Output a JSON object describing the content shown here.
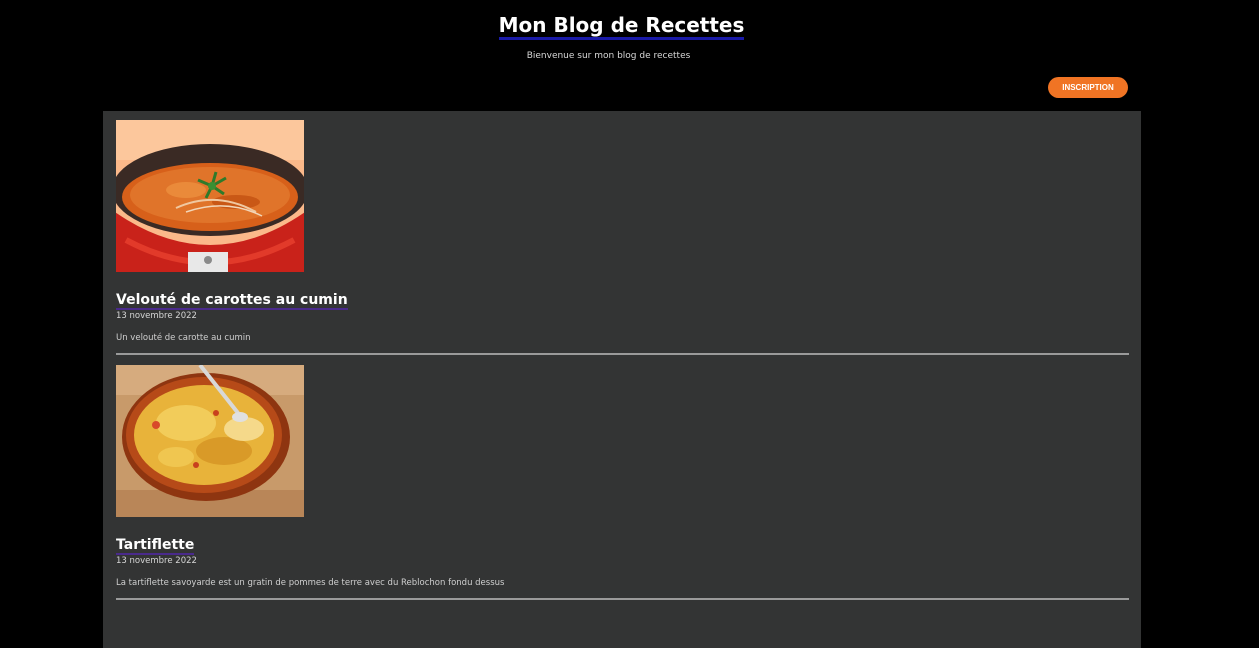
{
  "header": {
    "title": "Mon Blog de Recettes",
    "subtitle": "Bienvenue sur mon blog de recettes",
    "signup_label": "INSCRIPTION"
  },
  "articles": [
    {
      "title": "Velouté de carottes au cumin",
      "date": "13 novembre 2022",
      "excerpt": "Un velouté de carotte au cumin",
      "image": "carrot-soup-image"
    },
    {
      "title": "Tartiflette",
      "date": "13 novembre 2022",
      "excerpt": "La tartiflette savoyarde est un gratin de pommes de terre avec du Reblochon fondu dessus",
      "image": "tartiflette-image"
    }
  ],
  "colors": {
    "background": "#000000",
    "content_background": "#333434",
    "accent": "#f07424",
    "title_underline": "#1a1aa8"
  }
}
